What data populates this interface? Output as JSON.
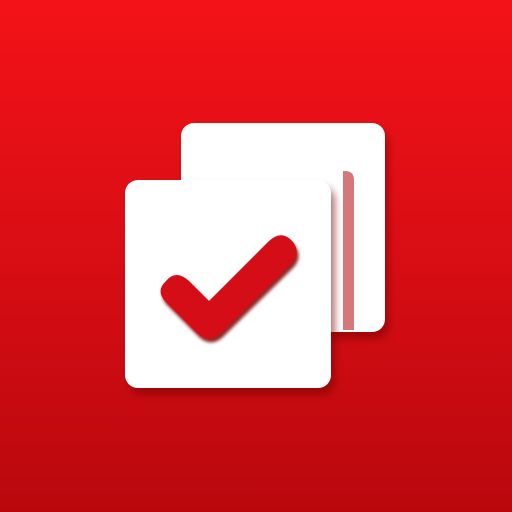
{
  "app_icon": {
    "name": "checklist-copy-icon",
    "colors": {
      "background_top": "#f31217",
      "background_mid": "#d90e14",
      "background_bottom": "#b9080d",
      "card": "#ffffff",
      "shadow": "#8f0307",
      "check_fill": "#d50d12",
      "check_shadow": "#7e0206"
    },
    "icons": [
      "back-card-icon",
      "front-card-icon",
      "checkmark-icon"
    ]
  }
}
